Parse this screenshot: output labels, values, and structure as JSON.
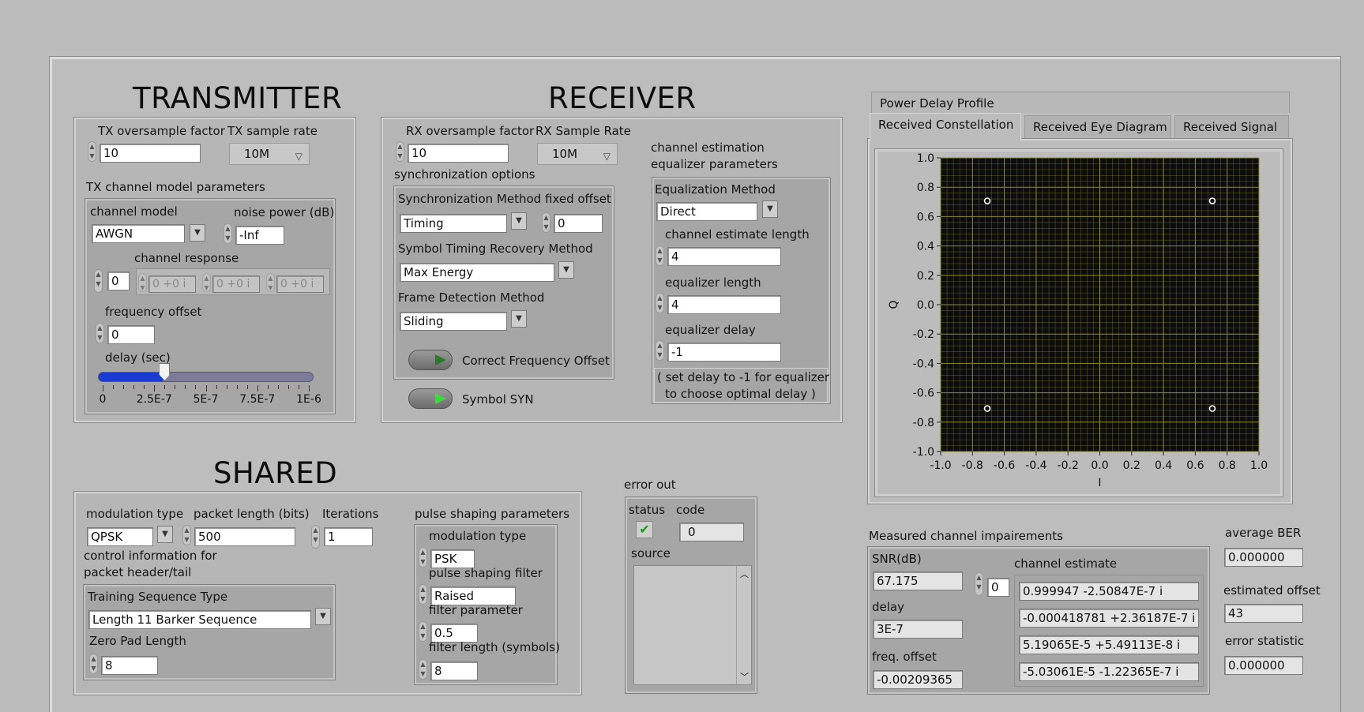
{
  "transmitter": {
    "title": "TRANSMITTER",
    "tx_oversample_label": "TX oversample factor",
    "tx_oversample_value": "10",
    "tx_sample_rate_label": "TX sample rate",
    "tx_sample_rate_value": "10M",
    "channel_model_params_label": "TX channel model parameters",
    "channel_model_label": "channel model",
    "channel_model_value": "AWGN",
    "noise_power_label": "noise power (dB)",
    "noise_power_value": "-Inf",
    "channel_response_label": "channel response",
    "channel_response_index": "0",
    "channel_response_values": [
      "0 +0 i",
      "0 +0 i",
      "0 +0 i"
    ],
    "frequency_offset_label": "frequency offset",
    "frequency_offset_value": "0",
    "delay_label": "delay (sec)",
    "delay_slider_fraction": 0.3,
    "delay_ticks": [
      "0",
      "2.5E-7",
      "5E-7",
      "7.5E-7",
      "1E-6"
    ]
  },
  "receiver": {
    "title": "RECEIVER",
    "rx_oversample_label": "RX oversample factor",
    "rx_oversample_value": "10",
    "rx_sample_rate_label": "RX Sample Rate",
    "rx_sample_rate_value": "10M",
    "sync_options_label": "synchronization options",
    "sync_method_label": "Synchronization Method",
    "sync_method_value": "Timing",
    "fixed_offset_label": "fixed offset",
    "fixed_offset_value": "0",
    "symbol_timing_label": "Symbol Timing Recovery Method",
    "symbol_timing_value": "Max Energy",
    "frame_detection_label": "Frame Detection Method",
    "frame_detection_value": "Sliding",
    "correct_freq_label": "Correct Frequency Offset",
    "symbol_syn_label": "Symbol SYN",
    "chan_est_label_1": "channel estimation",
    "chan_est_label_2": "equalizer parameters",
    "eq_method_label": "Equalization Method",
    "eq_method_value": "Direct",
    "chan_est_len_label": "channel estimate length",
    "chan_est_len_value": "4",
    "eq_len_label": "equalizer length",
    "eq_len_value": "4",
    "eq_delay_label": "equalizer delay",
    "eq_delay_value": "-1",
    "note_line1": "( set delay to -1 for equalizer",
    "note_line2": "to choose optimal delay )"
  },
  "tabs": {
    "power_delay": "Power Delay Profile",
    "constellation": "Received Constellation",
    "eye": "Received Eye Diagram",
    "signal": "Received Signal"
  },
  "chart_data": {
    "type": "scatter",
    "xlabel": "I",
    "ylabel": "Q",
    "xlim": [
      -1.0,
      1.0
    ],
    "ylim": [
      -1.0,
      1.0
    ],
    "x_ticks": [
      "-1.0",
      "-0.8",
      "-0.6",
      "-0.4",
      "-0.2",
      "0.0",
      "0.2",
      "0.4",
      "0.6",
      "0.8",
      "1.0"
    ],
    "y_ticks": [
      "1.0",
      "0.8",
      "0.6",
      "0.4",
      "0.2",
      "0.0",
      "-0.2",
      "-0.4",
      "-0.6",
      "-0.8",
      "-1.0"
    ],
    "grid": true,
    "background": "#0c0c0c",
    "grid_color": "#8d8d2c",
    "points": [
      {
        "x": -0.707,
        "y": 0.707
      },
      {
        "x": 0.707,
        "y": 0.707
      },
      {
        "x": -0.707,
        "y": -0.707
      },
      {
        "x": 0.707,
        "y": -0.707
      }
    ]
  },
  "shared": {
    "title": "SHARED",
    "modulation_type_label": "modulation type",
    "modulation_type_value": "QPSK",
    "packet_length_label": "packet length (bits)",
    "packet_length_value": "500",
    "iterations_label": "Iterations",
    "iterations_value": "1",
    "control_info_line1": "control information for",
    "control_info_line2": "packet header/tail",
    "training_type_label": "Training Sequence Type",
    "training_type_value": "Length 11 Barker Sequence",
    "zero_pad_label": "Zero Pad Length",
    "zero_pad_value": "8",
    "pulse_params_label": "pulse shaping parameters",
    "pulse_mod_type_label": "modulation type",
    "pulse_mod_type_value": "PSK",
    "pulse_filter_label": "pulse shaping filter",
    "pulse_filter_value": "Raised",
    "filter_param_label": "filter parameter",
    "filter_param_value": "0.5",
    "filter_length_label": "filter length (symbols)",
    "filter_length_value": "8"
  },
  "error_out": {
    "label": "error out",
    "status_label": "status",
    "code_label": "code",
    "code_value": "0",
    "source_label": "source"
  },
  "measured": {
    "label": "Measured channel impairements",
    "snr_label": "SNR(dB)",
    "snr_value": "67.175",
    "delay_label": "delay",
    "delay_value": "3E-7",
    "freq_offset_label": "freq. offset",
    "freq_offset_value": "-0.00209365",
    "chan_est_label": "channel estimate",
    "chan_est_index": "0",
    "chan_est_values": [
      "0.999947 -2.50847E-7 i",
      "-0.000418781 +2.36187E-7 i",
      "5.19065E-5 +5.49113E-8 i",
      "-5.03061E-5 -1.22365E-7 i"
    ]
  },
  "stats": {
    "avg_ber_label": "average BER",
    "avg_ber_value": "0.000000",
    "est_offset_label": "estimated offset",
    "est_offset_value": "43",
    "error_stat_label": "error statistic",
    "error_stat_value": "0.000000"
  }
}
